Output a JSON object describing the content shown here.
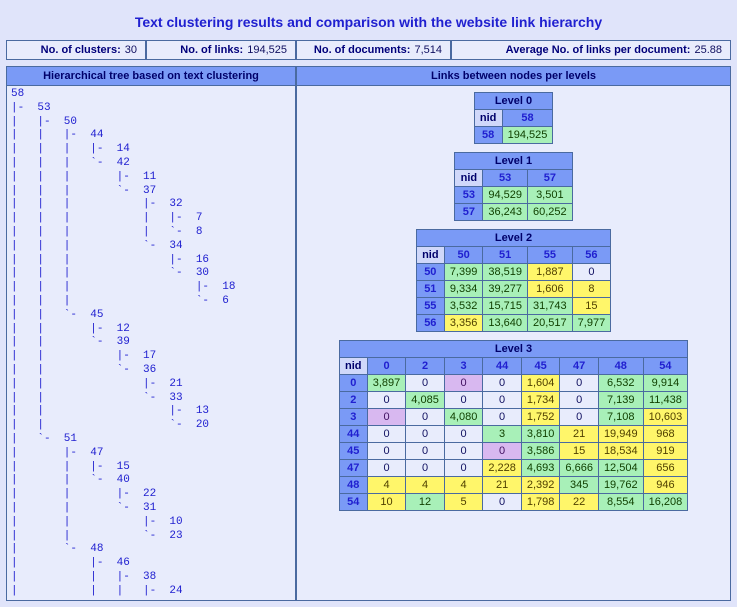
{
  "title": "Text clustering results and comparison with the website link hierarchy",
  "stats": {
    "clusters_label": "No. of clusters:",
    "clusters": "30",
    "links_label": "No. of links:",
    "links": "194,525",
    "docs_label": "No. of documents:",
    "docs": "7,514",
    "avg_label": "Average No. of links per document:",
    "avg": "25.88"
  },
  "left_header": "Hierarchical tree based on text clustering",
  "right_header": "Links between nodes per levels",
  "tree_text": "58\n|-  53\n|   |-  50\n|   |   |-  44\n|   |   |   |-  14\n|   |   |   `-  42\n|   |   |       |-  11\n|   |   |       `-  37\n|   |   |           |-  32\n|   |   |           |   |-  7\n|   |   |           |   `-  8\n|   |   |           `-  34\n|   |   |               |-  16\n|   |   |               `-  30\n|   |   |                   |-  18\n|   |   |                   `-  6\n|   |   `-  45\n|   |       |-  12\n|   |       `-  39\n|   |           |-  17\n|   |           `-  36\n|   |               |-  21\n|   |               `-  33\n|   |                   |-  13\n|   |                   `-  20\n|   `-  51\n|       |-  47\n|       |   |-  15\n|       |   `-  40\n|       |       |-  22\n|       |       `-  31\n|       |           |-  10\n|       |           `-  23\n|       `-  48\n|           |-  46\n|           |   |-  38\n|           |   |   |-  24",
  "levels": [
    {
      "caption": "Level 0",
      "nid": "nid",
      "cols": [
        "58"
      ],
      "rows": [
        {
          "h": "58",
          "cells": [
            {
              "v": "194,525",
              "c": "g"
            }
          ]
        }
      ]
    },
    {
      "caption": "Level 1",
      "nid": "nid",
      "cols": [
        "53",
        "57"
      ],
      "rows": [
        {
          "h": "53",
          "cells": [
            {
              "v": "94,529",
              "c": "g"
            },
            {
              "v": "3,501",
              "c": "g"
            }
          ]
        },
        {
          "h": "57",
          "cells": [
            {
              "v": "36,243",
              "c": "g"
            },
            {
              "v": "60,252",
              "c": "g"
            }
          ]
        }
      ]
    },
    {
      "caption": "Level 2",
      "nid": "nid",
      "cols": [
        "50",
        "51",
        "55",
        "56"
      ],
      "rows": [
        {
          "h": "50",
          "cells": [
            {
              "v": "7,399",
              "c": "g"
            },
            {
              "v": "38,519",
              "c": "g"
            },
            {
              "v": "1,887",
              "c": "y"
            },
            {
              "v": "0",
              "c": "w"
            }
          ]
        },
        {
          "h": "51",
          "cells": [
            {
              "v": "9,334",
              "c": "g"
            },
            {
              "v": "39,277",
              "c": "g"
            },
            {
              "v": "1,606",
              "c": "y"
            },
            {
              "v": "8",
              "c": "y"
            }
          ]
        },
        {
          "h": "55",
          "cells": [
            {
              "v": "3,532",
              "c": "g"
            },
            {
              "v": "15,715",
              "c": "g"
            },
            {
              "v": "31,743",
              "c": "g"
            },
            {
              "v": "15",
              "c": "y"
            }
          ]
        },
        {
          "h": "56",
          "cells": [
            {
              "v": "3,356",
              "c": "y"
            },
            {
              "v": "13,640",
              "c": "g"
            },
            {
              "v": "20,517",
              "c": "g"
            },
            {
              "v": "7,977",
              "c": "g"
            }
          ]
        }
      ]
    },
    {
      "caption": "Level 3",
      "nid": "nid",
      "cols": [
        "0",
        "2",
        "3",
        "44",
        "45",
        "47",
        "48",
        "54"
      ],
      "rows": [
        {
          "h": "0",
          "cells": [
            {
              "v": "3,897",
              "c": "g"
            },
            {
              "v": "0",
              "c": "w"
            },
            {
              "v": "0",
              "c": "p"
            },
            {
              "v": "0",
              "c": "w"
            },
            {
              "v": "1,604",
              "c": "y"
            },
            {
              "v": "0",
              "c": "w"
            },
            {
              "v": "6,532",
              "c": "g"
            },
            {
              "v": "9,914",
              "c": "g"
            }
          ]
        },
        {
          "h": "2",
          "cells": [
            {
              "v": "0",
              "c": "w"
            },
            {
              "v": "4,085",
              "c": "g"
            },
            {
              "v": "0",
              "c": "w"
            },
            {
              "v": "0",
              "c": "w"
            },
            {
              "v": "1,734",
              "c": "y"
            },
            {
              "v": "0",
              "c": "w"
            },
            {
              "v": "7,139",
              "c": "g"
            },
            {
              "v": "11,438",
              "c": "g"
            }
          ]
        },
        {
          "h": "3",
          "cells": [
            {
              "v": "0",
              "c": "p"
            },
            {
              "v": "0",
              "c": "w"
            },
            {
              "v": "4,080",
              "c": "g"
            },
            {
              "v": "0",
              "c": "w"
            },
            {
              "v": "1,752",
              "c": "y"
            },
            {
              "v": "0",
              "c": "w"
            },
            {
              "v": "7,108",
              "c": "g"
            },
            {
              "v": "10,603",
              "c": "y"
            }
          ]
        },
        {
          "h": "44",
          "cells": [
            {
              "v": "0",
              "c": "w"
            },
            {
              "v": "0",
              "c": "w"
            },
            {
              "v": "0",
              "c": "w"
            },
            {
              "v": "3",
              "c": "g"
            },
            {
              "v": "3,810",
              "c": "g"
            },
            {
              "v": "21",
              "c": "y"
            },
            {
              "v": "19,949",
              "c": "y"
            },
            {
              "v": "968",
              "c": "y"
            }
          ]
        },
        {
          "h": "45",
          "cells": [
            {
              "v": "0",
              "c": "w"
            },
            {
              "v": "0",
              "c": "w"
            },
            {
              "v": "0",
              "c": "w"
            },
            {
              "v": "0",
              "c": "p"
            },
            {
              "v": "3,586",
              "c": "g"
            },
            {
              "v": "15",
              "c": "y"
            },
            {
              "v": "18,534",
              "c": "y"
            },
            {
              "v": "919",
              "c": "y"
            }
          ]
        },
        {
          "h": "47",
          "cells": [
            {
              "v": "0",
              "c": "w"
            },
            {
              "v": "0",
              "c": "w"
            },
            {
              "v": "0",
              "c": "w"
            },
            {
              "v": "2,228",
              "c": "y"
            },
            {
              "v": "4,693",
              "c": "g"
            },
            {
              "v": "6,666",
              "c": "g"
            },
            {
              "v": "12,504",
              "c": "g"
            },
            {
              "v": "656",
              "c": "y"
            }
          ]
        },
        {
          "h": "48",
          "cells": [
            {
              "v": "4",
              "c": "y"
            },
            {
              "v": "4",
              "c": "y"
            },
            {
              "v": "4",
              "c": "y"
            },
            {
              "v": "21",
              "c": "y"
            },
            {
              "v": "2,392",
              "c": "y"
            },
            {
              "v": "345",
              "c": "g"
            },
            {
              "v": "19,762",
              "c": "g"
            },
            {
              "v": "946",
              "c": "y"
            }
          ]
        },
        {
          "h": "54",
          "cells": [
            {
              "v": "10",
              "c": "y"
            },
            {
              "v": "12",
              "c": "g"
            },
            {
              "v": "5",
              "c": "y"
            },
            {
              "v": "0",
              "c": "w"
            },
            {
              "v": "1,798",
              "c": "y"
            },
            {
              "v": "22",
              "c": "y"
            },
            {
              "v": "8,554",
              "c": "g"
            },
            {
              "v": "16,208",
              "c": "g"
            }
          ]
        }
      ]
    }
  ]
}
